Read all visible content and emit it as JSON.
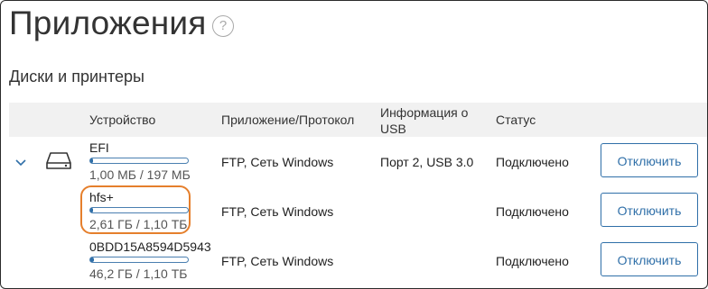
{
  "page": {
    "title": "Приложения",
    "help_icon": "?",
    "section_title": "Диски и принтеры"
  },
  "table": {
    "headers": {
      "device": "Устройство",
      "app": "Приложение/Протокол",
      "usb": "Информация о USB",
      "status": "Статус"
    },
    "rows": [
      {
        "name": "EFI",
        "usage_fraction": 0.005,
        "size": "1,00 МБ / 197 МБ",
        "app": "FTP, Сеть Windows",
        "usb": "Порт 2, USB 3.0",
        "status": "Подключено",
        "button": "Отключить"
      },
      {
        "name": "hfs+",
        "usage_fraction": 0.002,
        "size": "2,61 ГБ / 1,10 ТБ",
        "app": "FTP, Сеть Windows",
        "usb": "",
        "status": "Подключено",
        "button": "Отключить"
      },
      {
        "name": "0BDD15A8594D5943",
        "usage_fraction": 0.04,
        "size": "46,2 ГБ / 1,10 ТБ",
        "app": "FTP, Сеть Windows",
        "usb": "",
        "status": "Подключено",
        "button": "Отключить"
      }
    ]
  },
  "colors": {
    "accent": "#2f6fa8",
    "highlight": "#e57f2c",
    "header_bg": "#f1f1f1"
  },
  "icons": {
    "expand": "chevron-down-icon",
    "drive": "hard-drive-icon",
    "help": "help-icon"
  }
}
